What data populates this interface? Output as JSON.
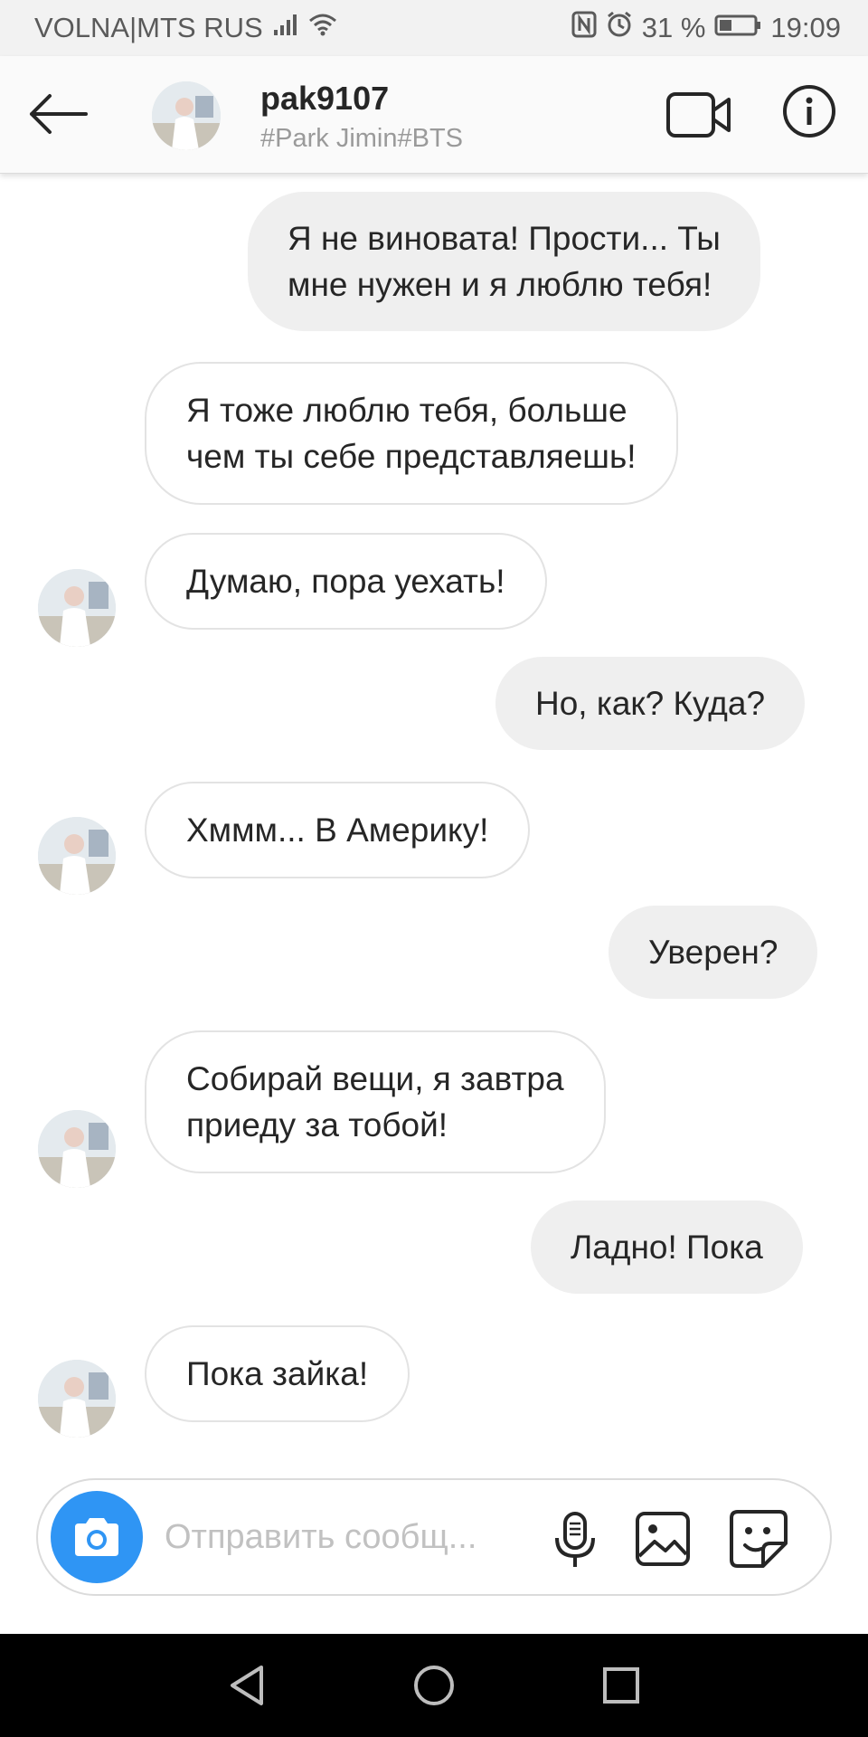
{
  "status_bar": {
    "carrier": "VOLNA|MTS RUS",
    "battery": "31 %",
    "time": "19:09"
  },
  "header": {
    "username": "pak9107",
    "subtitle": "#Park Jimin#BTS"
  },
  "messages": [
    {
      "direction": "outgoing",
      "text": "Я не виновата! Прости... Ты\nмне нужен и я люблю тебя!"
    },
    {
      "direction": "incoming",
      "text": "Я тоже люблю тебя, больше\nчем ты себе представляешь!"
    },
    {
      "direction": "incoming",
      "text": "Думаю, пора уехать!"
    },
    {
      "direction": "outgoing",
      "text": "Но, как? Куда?"
    },
    {
      "direction": "incoming",
      "text": "Хммм... В Америку!"
    },
    {
      "direction": "outgoing",
      "text": "Уверен?"
    },
    {
      "direction": "incoming",
      "text": "Собирай вещи, я завтра\nприеду за тобой!"
    },
    {
      "direction": "outgoing",
      "text": "Ладно! Пока"
    },
    {
      "direction": "incoming",
      "text": "Пока зайка!"
    }
  ],
  "composer": {
    "placeholder": "Отправить сообщ...",
    "value": ""
  },
  "colors": {
    "accent": "#2f95f4",
    "outgoing_bubble": "#efefef",
    "incoming_border": "#e3e3e3",
    "nav_bar": "#000000"
  },
  "icons": [
    "signal-icon",
    "wifi-icon",
    "nfc-icon",
    "alarm-icon",
    "battery-icon",
    "back-arrow-icon",
    "video-call-icon",
    "info-icon",
    "camera-icon",
    "microphone-icon",
    "gallery-icon",
    "sticker-icon",
    "nav-back-icon",
    "nav-home-icon",
    "nav-recents-icon"
  ]
}
